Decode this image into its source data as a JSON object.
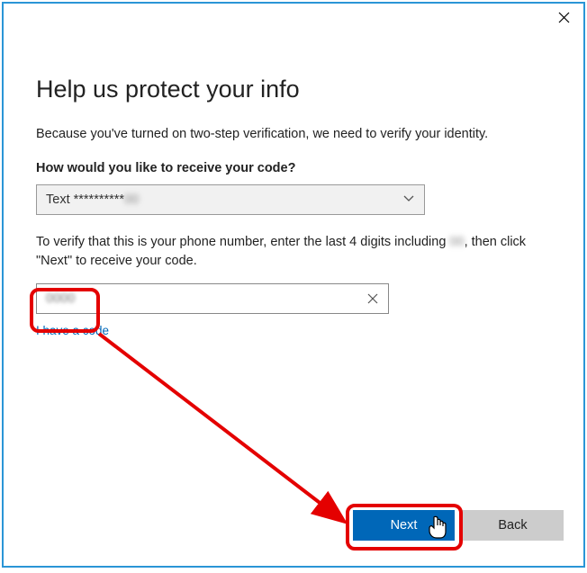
{
  "title": "Help us protect your info",
  "description": "Because you've turned on two-step verification, we need to verify your identity.",
  "question": "How would you like to receive your code?",
  "select_value": "Text **********",
  "verify_text_1": "To verify that this is your phone number, enter the last 4 digits including ",
  "verify_text_2": ", then click \"Next\" to receive your code.",
  "input_value": "0000",
  "have_code": "I have a code",
  "next_label": "Next",
  "back_label": "Back"
}
